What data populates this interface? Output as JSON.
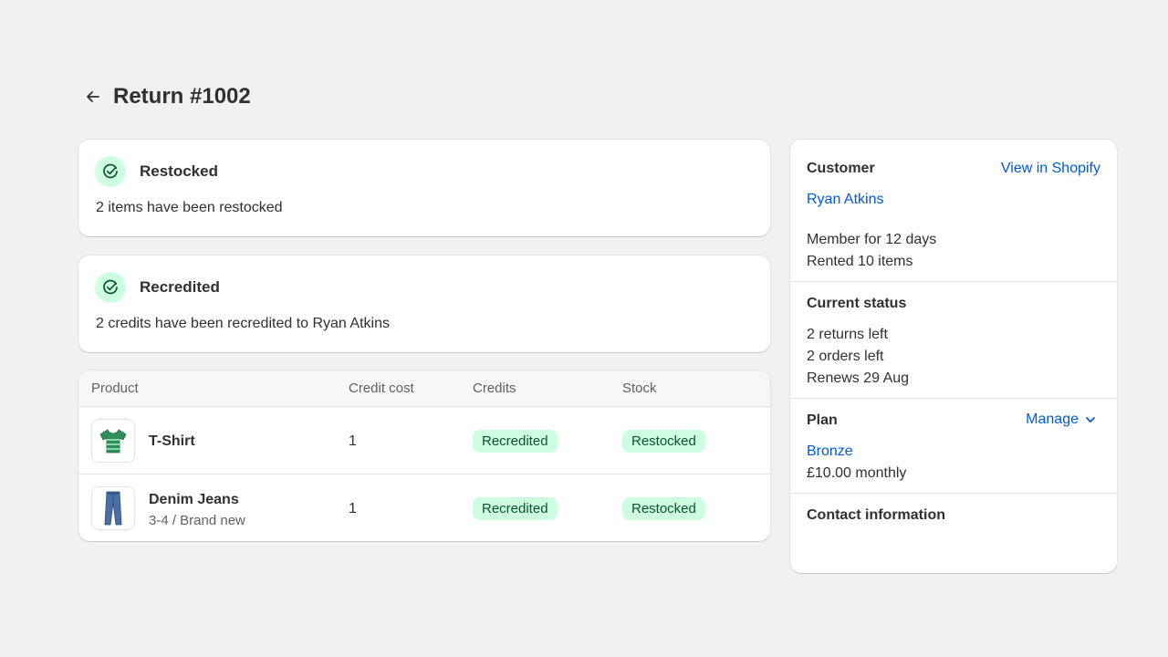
{
  "header": {
    "title": "Return #1002"
  },
  "restocked": {
    "title": "Restocked",
    "description": "2 items have been restocked"
  },
  "recredited": {
    "title": "Recredited",
    "description": "2 credits have been recredited to Ryan Atkins"
  },
  "table": {
    "columns": [
      "Product",
      "Credit cost",
      "Credits",
      "Stock"
    ],
    "rows": [
      {
        "name": "T-Shirt",
        "variant": "",
        "credit_cost": "1",
        "credits": "Recredited",
        "stock": "Restocked",
        "thumbnail_icon": "tshirt-icon"
      },
      {
        "name": "Denim Jeans",
        "variant": "3-4 / Brand new",
        "credit_cost": "1",
        "credits": "Recredited",
        "stock": "Restocked",
        "thumbnail_icon": "jeans-icon"
      }
    ]
  },
  "customer": {
    "title": "Customer",
    "view_link": "View in Shopify",
    "name": "Ryan Atkins",
    "member": "Member for 12 days",
    "rented": "Rented 10 items"
  },
  "current_status": {
    "title": "Current status",
    "returns_left": "2 returns left",
    "orders_left": "2 orders left",
    "renews": "Renews 29 Aug"
  },
  "plan": {
    "title": "Plan",
    "manage_label": "Manage",
    "name": "Bronze",
    "price": "£10.00 monthly"
  },
  "contact": {
    "title": "Contact information"
  },
  "colors": {
    "accent_link": "#005bd3",
    "success_bg": "#cdfee1",
    "success_text": "#0c5132",
    "page_bg": "#f1f1f1"
  }
}
